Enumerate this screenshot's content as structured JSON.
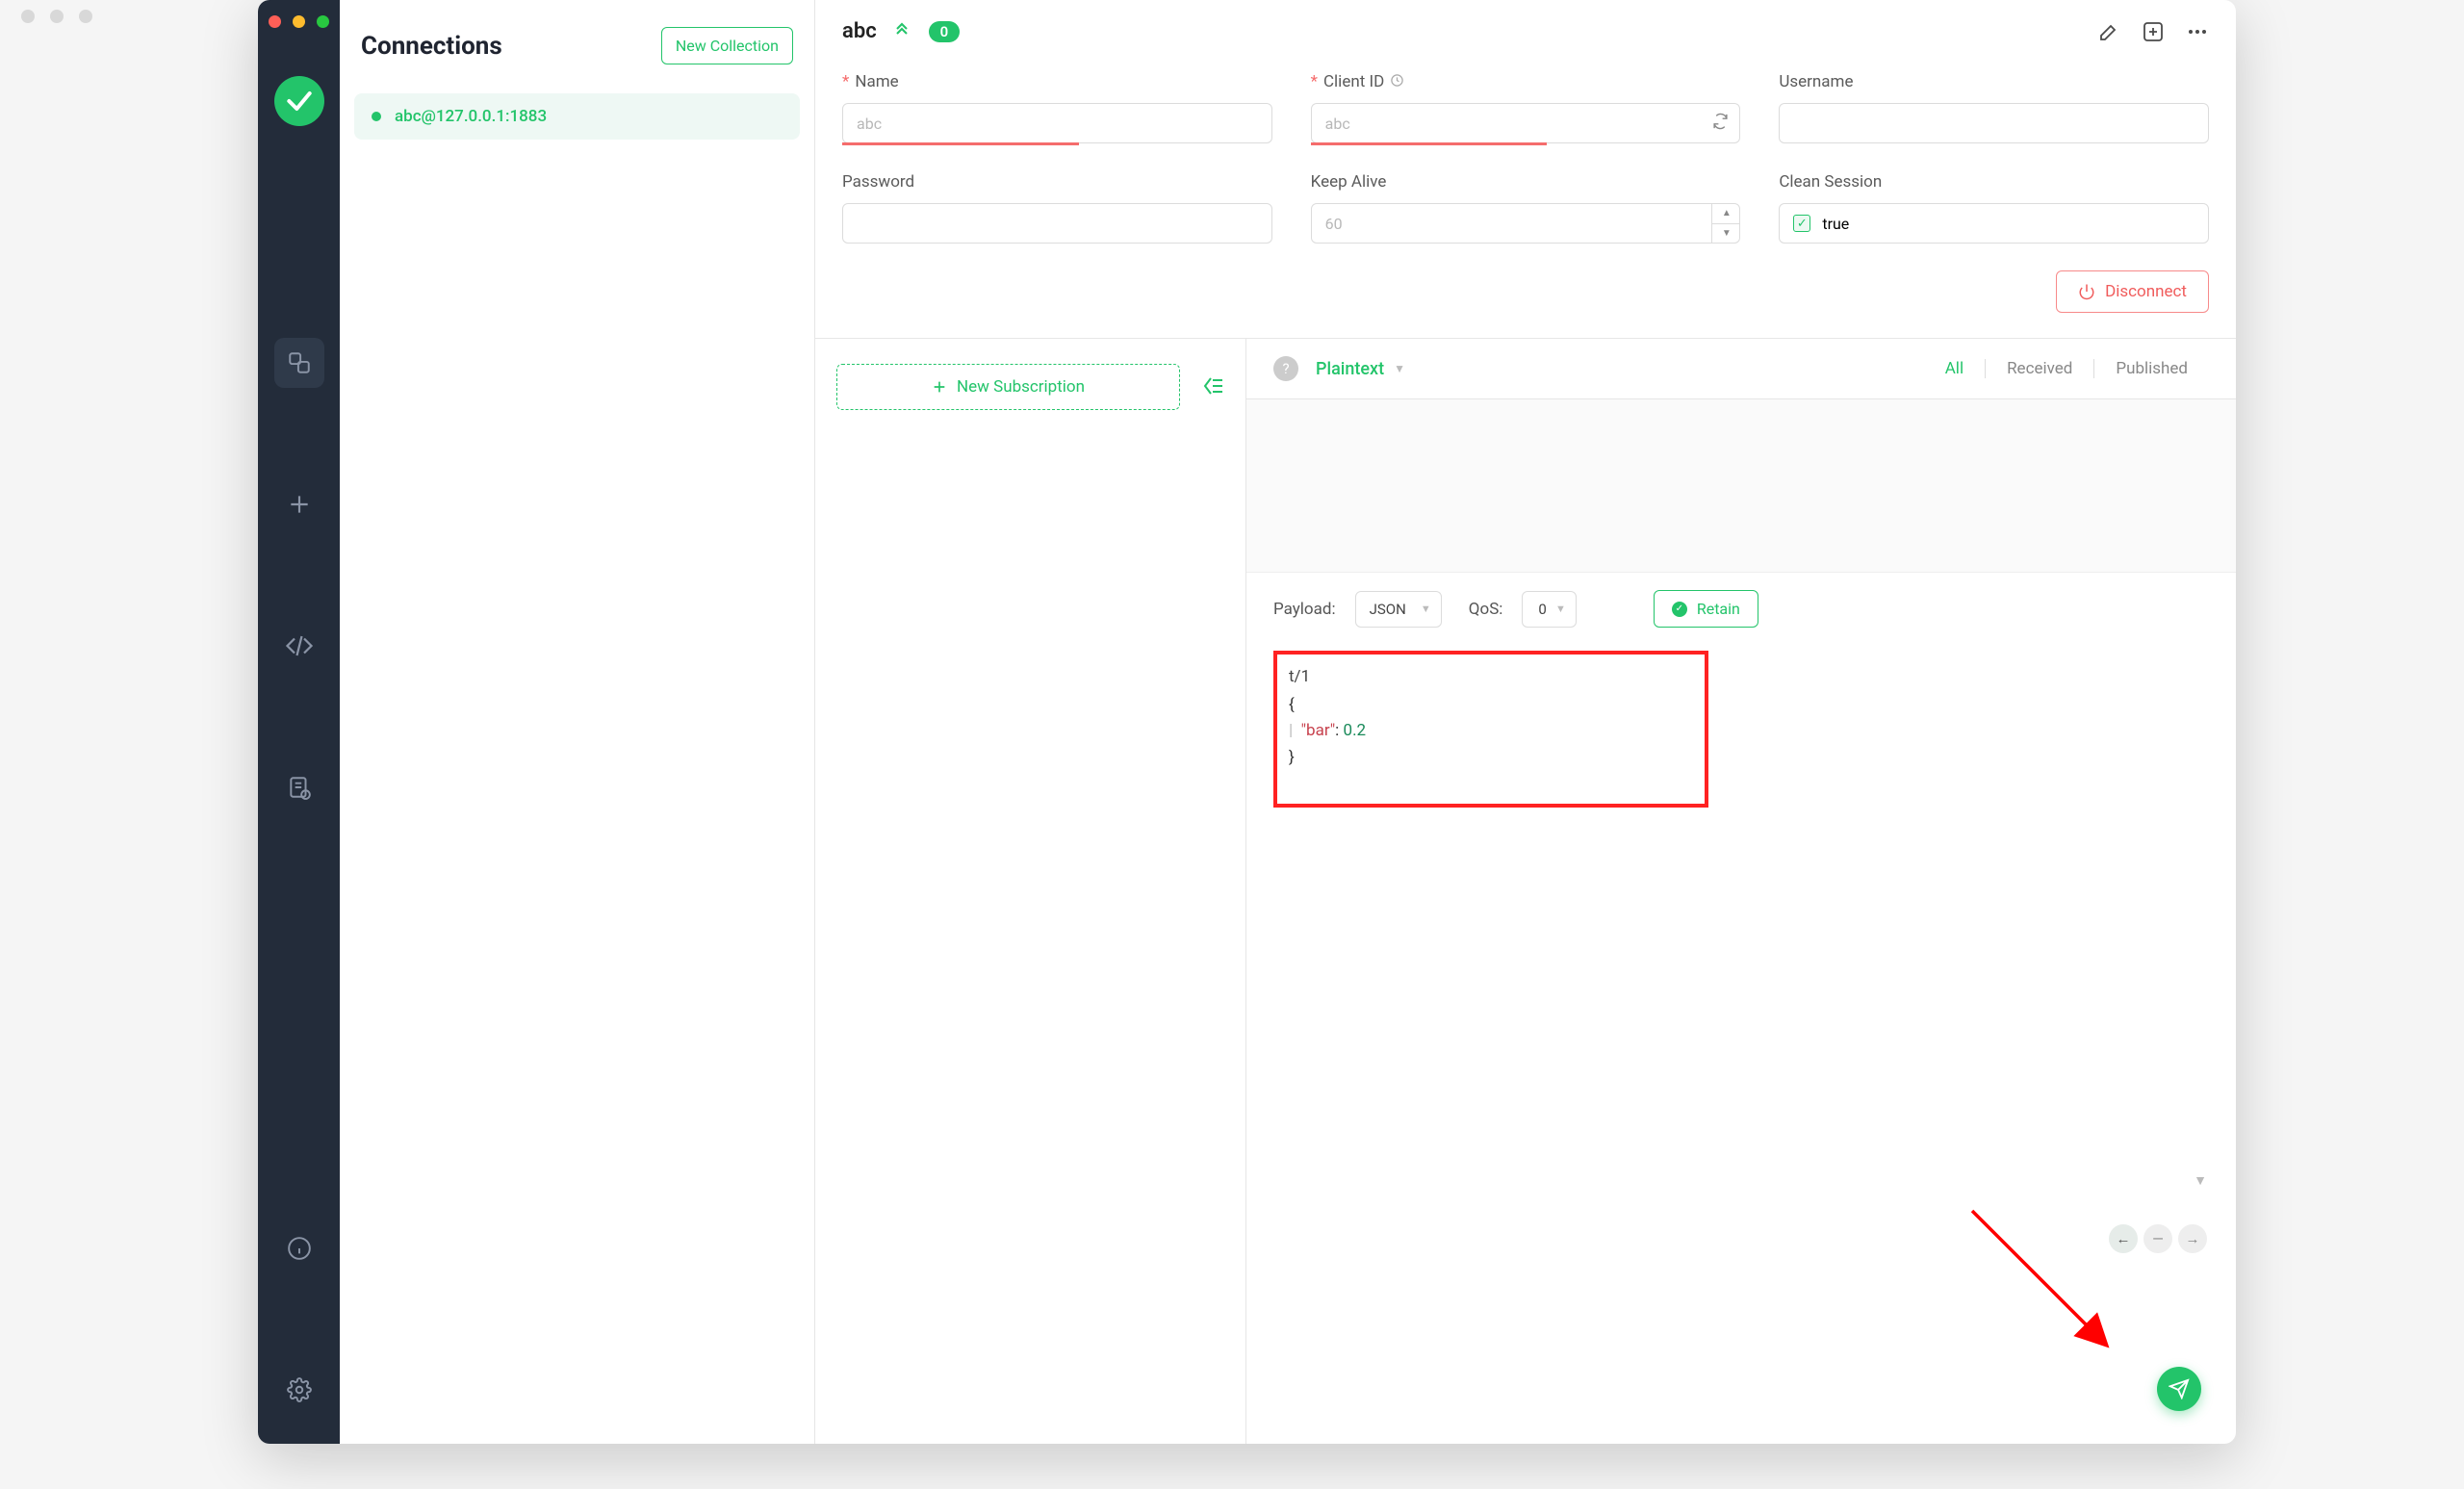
{
  "connectionsPanel": {
    "title": "Connections",
    "newCollectionLabel": "New Collection",
    "items": [
      {
        "label": "abc@127.0.0.1:1883",
        "status": "connected"
      }
    ]
  },
  "topBar": {
    "name": "abc",
    "badge": "0"
  },
  "form": {
    "name": {
      "label": "Name",
      "placeholder": "abc",
      "required": true
    },
    "clientId": {
      "label": "Client ID",
      "placeholder": "abc",
      "required": true
    },
    "username": {
      "label": "Username",
      "value": ""
    },
    "password": {
      "label": "Password",
      "value": ""
    },
    "keepAlive": {
      "label": "Keep Alive",
      "placeholder": "60"
    },
    "cleanSession": {
      "label": "Clean Session",
      "value": "true"
    }
  },
  "disconnectLabel": "Disconnect",
  "newSubscriptionLabel": "New Subscription",
  "messageHead": {
    "format": "Plaintext",
    "tabs": {
      "all": "All",
      "received": "Received",
      "published": "Published"
    }
  },
  "payloadBar": {
    "payloadLabel": "Payload:",
    "payloadFormat": "JSON",
    "qosLabel": "QoS:",
    "qosValue": "0",
    "retainLabel": "Retain"
  },
  "payloadEditor": {
    "topic": "t/1",
    "jsonKey": "\"bar\"",
    "jsonVal": "0.2"
  }
}
